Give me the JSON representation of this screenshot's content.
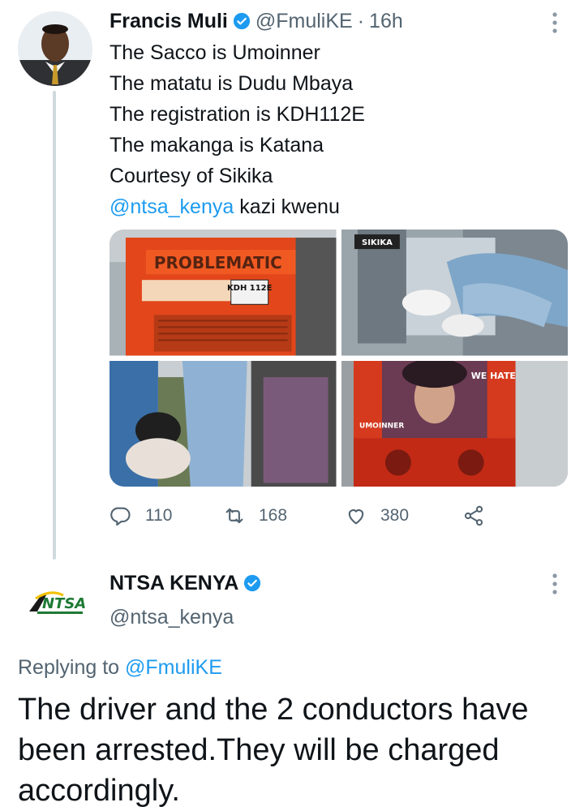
{
  "tweet": {
    "author_name": "Francis Muli",
    "author_handle": "@FmuliKE",
    "separator": "·",
    "time": "16h",
    "lines": [
      "The Sacco is Umoinner",
      "The matatu is Dudu Mbaya",
      "The registration is KDH112E",
      "The makanga is Katana",
      "Courtesy of Sikika"
    ],
    "mention": "@ntsa_kenya",
    "mention_suffix": " kazi kwenu",
    "media": {
      "photo1_plate": "KDH 112E",
      "photo2_watermark": "SIKIKA",
      "photo4_text": "WE HATE SENSE",
      "photo4_sacco": "UMOINNER"
    },
    "stats": {
      "replies": "110",
      "retweets": "168",
      "likes": "380"
    }
  },
  "reply": {
    "author_name": "NTSA KENYA",
    "author_handle": "@ntsa_kenya",
    "logo_text": "NTSA",
    "replying_prefix": "Replying to ",
    "replying_handle": "@FmuliKE",
    "text": "The driver and the 2 conductors have been arrested.They will be charged accordingly."
  },
  "colors": {
    "accent": "#1d9bf0",
    "secondary_text": "#536471",
    "verified": "#1d9bf0"
  },
  "icons": [
    "verified-badge-icon",
    "more-options-icon",
    "reply-icon",
    "retweet-icon",
    "like-icon",
    "share-icon"
  ]
}
